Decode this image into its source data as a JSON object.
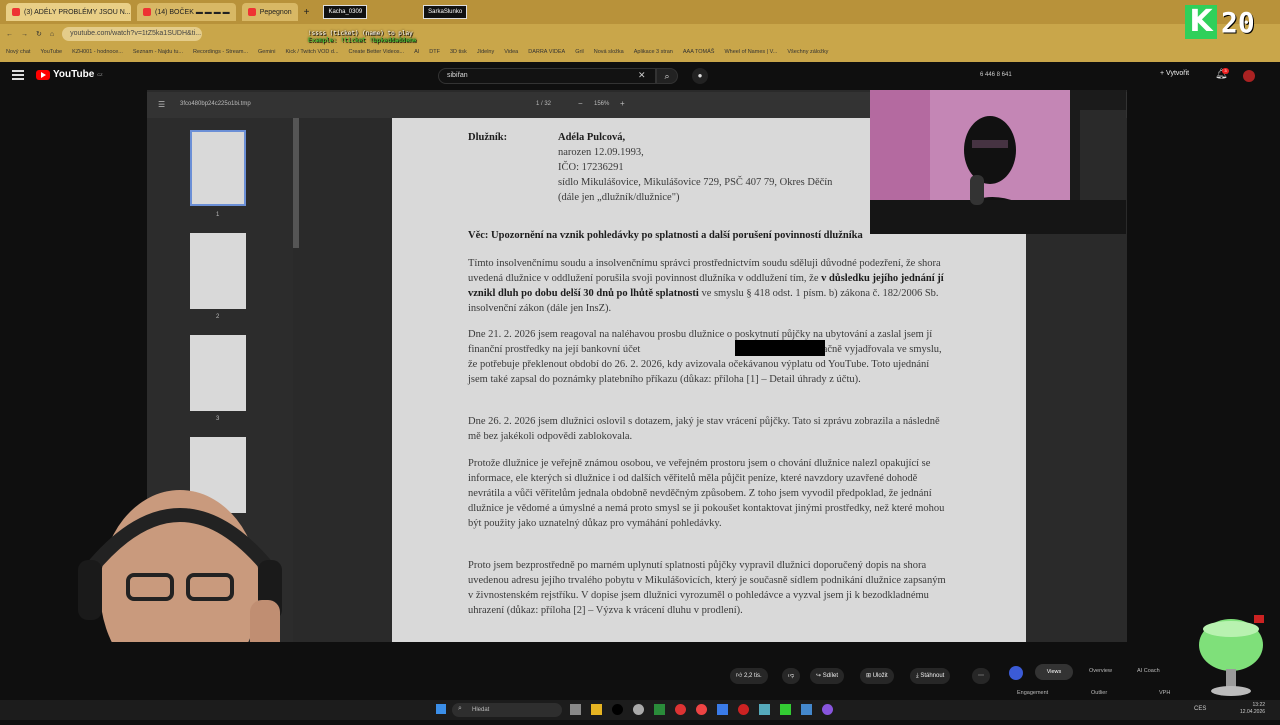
{
  "browser": {
    "tabs": [
      {
        "label": "(3) ADÉLY PROBLÉMY JSOU N...",
        "active": true
      },
      {
        "label": "(14) BOČEK ▬ ▬ ▬ ▬",
        "active": false
      },
      {
        "label": "Pepegnon",
        "active": false
      }
    ],
    "overlay_tabs": [
      "Kacha_0309",
      "SarkaSlunko"
    ],
    "url": "youtube.com/watch?v=1tZ5ka1SUDH&ti...",
    "bookmarks": [
      "Nový chat",
      "YouTube",
      "KZH001 - hodnoce...",
      "Seznam - Najdu tu...",
      "Recordings - Stream...",
      "Gemini",
      "Kick / Twitch VOD d...",
      "Create Better Videos...",
      "AI",
      "DTF",
      "3D tisk",
      "Jídelny",
      "Videa",
      "DARRA VIDEA",
      "Gril",
      "Nová složka",
      "Aplikace 3 stran",
      "AAA TOMÁŠ",
      "Wheel of Names | V...",
      "Všechny záložky"
    ]
  },
  "stream_overlay": {
    "chat_line1": "!ssss (ticket) (name) to play",
    "chat_line2": "Example: !ticket !bpkeddaddeme",
    "counter": "20",
    "badge_letter": "K"
  },
  "youtube": {
    "logo_text": "YouTube",
    "logo_country": "CZ",
    "search_value": "sibiřan",
    "stats": "6 446  8  641",
    "create_label": "Vytvořit",
    "notifications": "3",
    "actions": {
      "likes": "2,2 tis.",
      "share": "Sdílet",
      "save": "Uložit",
      "download": "Stáhnout",
      "more": "⋯"
    },
    "analytics": {
      "tabs": [
        "Views",
        "Overview",
        "AI Coach"
      ],
      "sub": [
        "Engagement",
        "Outlier",
        "VPH"
      ]
    }
  },
  "pdf_viewer": {
    "file_name": "3fco480bp24c225o1bi.tmp",
    "page_indicator": "1 / 32",
    "zoom": "156%",
    "thumbnail_numbers": [
      "1",
      "2",
      "3",
      "4"
    ]
  },
  "document": {
    "debtor_label": "Dlužník:",
    "debtor_name": "Adéla Pulcová,",
    "debtor_born": "narozen 12.09.1993,",
    "debtor_ico": "IČO: 17236291",
    "debtor_address": "sídlo Mikulášovice, Mikulášovice 729, PSČ 407 79, Okres Děčín",
    "debtor_alias": "(dále jen „dlužník/dlužnice\")",
    "subject": "Věc: Upozornění na vznik pohledávky po splatnosti a další porušení povinností dlužníka",
    "para1_start": "Tímto insolvenčnímu soudu a insolvenčnímu správci prostřednictvím soudu sděluji důvodné podezření, že shora uvedená dlužnice v oddlužení porušila svoji povinnost dlužníka v oddlužení tím, že ",
    "para1_bold": "v důsledku jejího jednání jí vznikl dluh po dobu delší 30 dnů po lhůtě splatnosti",
    "para1_end": " ve smyslu § 418 odst. 1 písm. b) zákona č. 182/2006 Sb. insolvenční zákon (dále jen InsZ).",
    "para2_start": "Dne 21. 2. 2026 jsem reagoval na naléhavou prosbu dlužnice o poskytnutí půjčky na ubytování a zaslal jsem jí finanční prostředky na její bankovní účet ",
    "para2_end": " Dlužnice se jednoznačně vyjadřovala ve smyslu, že potřebuje překlenout období do 26. 2. 2026, kdy avizovala očekávanou výplatu od YouTube. Toto ujednání jsem také zapsal do poznámky platebního příkazu (důkaz: příloha [1] – Detail úhrady z účtu).",
    "para3": "Dne 26. 2. 2026 jsem dlužnici oslovil s dotazem, jaký je stav vrácení půjčky. Tato si zprávu zobrazila a následně mě bez jakékoli odpovědi zablokovala.",
    "para4": "Protože dlužnice je veřejně známou osobou, ve veřejném prostoru jsem o chování dlužnice nalezl opakující se informace, ele kterých si dlužnice i od dalších věřitelů měla půjčit peníze, které navzdory uzavřené dohodě nevrátila a vůči věřitelům jednala obdobně nevděčným způsobem. Z toho jsem vyvodil předpoklad, že jednání dlužnice je vědomé a úmyslné a nemá proto smysl se ji pokoušet kontaktovat jinými prostředky, než které mohou být použity jako uznatelný důkaz pro vymáhání pohledávky.",
    "para5": "Proto jsem bezprostředně po marném uplynutí splatnosti půjčky vypravil dlužnici doporučený dopis na shora uvedenou adresu jejího trvalého pobytu v Mikulášovicích, který je současně sídlem podnikání dlužnice zapsaným v živnostenském rejstříku. V dopise jsem dlužnici vyrozuměl o pohledávce a vyzval jsem ji k bezodkladnému uhrazení (důkaz: příloha [2] – Výzva k vrácení dluhu v prodlení)."
  },
  "taskbar": {
    "search_placeholder": "Hledat",
    "language": "CES",
    "time": "13:22",
    "date": "12.04.2026"
  }
}
